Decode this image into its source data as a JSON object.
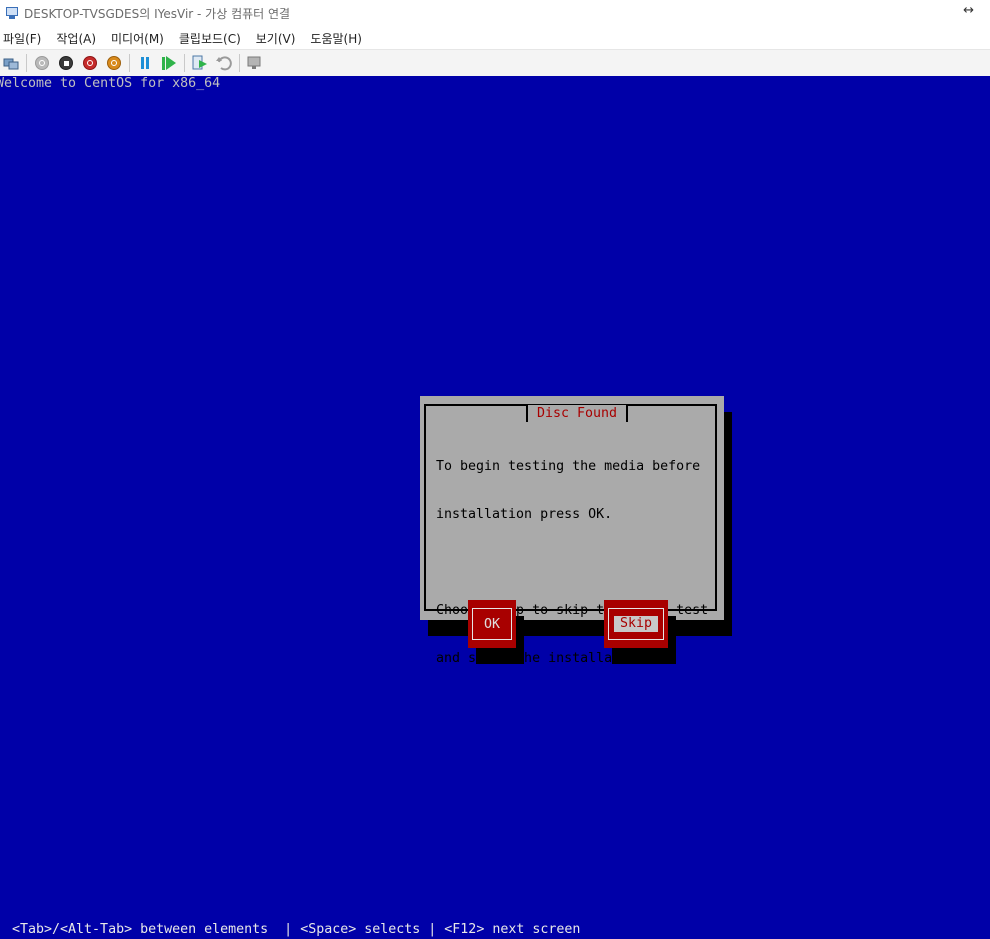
{
  "window": {
    "title": "DESKTOP-TVSGDES의 IYesVir - 가상 컴퓨터 연결",
    "resize_glyph": "↔"
  },
  "menu": [
    {
      "label": "파일(F)"
    },
    {
      "label": "작업(A)"
    },
    {
      "label": "미디어(M)"
    },
    {
      "label": "클립보드(C)"
    },
    {
      "label": "보기(V)"
    },
    {
      "label": "도움말(H)"
    }
  ],
  "toolbar": {
    "buttons": [
      "ctrl-alt-del-icon",
      "start-icon",
      "turn-off-icon",
      "shutdown-icon",
      "save-icon",
      "pause-icon",
      "resume-icon",
      "checkpoint-icon",
      "revert-icon",
      "enhanced-session-icon"
    ]
  },
  "console": {
    "welcome": "Welcome to CentOS for x86_64",
    "dialog": {
      "title": "Disc Found",
      "line1": "To begin testing the media before",
      "line2": "installation press OK.",
      "line3": "Choose Skip to skip the media test",
      "line4": "and start the installation.",
      "ok_label": "OK",
      "skip_label": "Skip"
    },
    "hint": "<Tab>/<Alt-Tab> between elements  | <Space> selects | <F12> next screen"
  },
  "colors": {
    "console_bg": "#0000a8",
    "dialog_bg": "#aaaaaa",
    "accent_red": "#a80000"
  }
}
